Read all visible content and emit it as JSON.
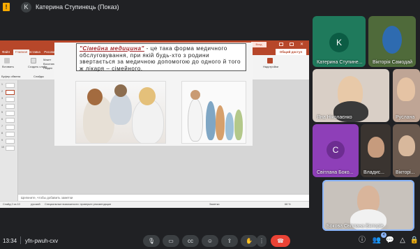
{
  "meet": {
    "presenter_initial": "K",
    "presenter_title": "Катерина Ступинець (Показ)",
    "time": "13:34",
    "meeting_code": "yfn-pwuh-cxv",
    "participants_badge": "4"
  },
  "powerpoint": {
    "window_title": "Загальне практика - сімейна медицина - PowerPoint",
    "signin": "Вход",
    "tabs": [
      "Файл",
      "Главная",
      "Вставка",
      "Рисование",
      "Конструктор",
      "Переходы",
      "Анимация",
      "Слайд-шоу",
      "Запись",
      "Рецензирование",
      "Вид",
      "Справка",
      "Что вы хотите сделать?"
    ],
    "active_tab_index": 1,
    "share_label": "Общий доступ",
    "ribbon": {
      "paste": "Вставить",
      "create_slide": "Создать слайд",
      "layout": "Макет",
      "reset": "Восстановить",
      "section": "Раздел",
      "shapes": "Фигуры",
      "arrange": "Упорядочить",
      "quick_styles": "Экспресс-стили",
      "find": "Найти",
      "replace": "Заменить",
      "select": "Выделить",
      "addins": "Надстройки",
      "clipboard": "Буфер обмена",
      "slides": "Слайды"
    },
    "slide_numbers": [
      "1",
      "2",
      "3",
      "4",
      "5",
      "6",
      "7",
      "8",
      "9",
      "10"
    ],
    "selected_slide": 2,
    "slide_lead": "\"Сімейна медицина\"",
    "slide_body": " - це така форма медичного обслуговування, при якій будь-хто з родини звертається за медичною допомогою до одного й того ж лікаря – сімейного.",
    "notes_placeholder": "Щелкните, чтобы добавить заметки",
    "status_slide": "Слайд 2 из 10",
    "status_lang": "русский",
    "status_accessibility": "Специальные возможности: проверьте рекомендации",
    "status_notes": "Заметки",
    "status_zoom": "68 %"
  },
  "participants": [
    {
      "name": "Катерина Ступине...",
      "initial": "K",
      "color": "#1f7a5c"
    },
    {
      "name": "Вікторія Самодай",
      "initial": "",
      "color": "#5a6e3c"
    },
    {
      "name": "Яна Ніколаєнко",
      "initial": "",
      "color": "#c9b8a6"
    },
    {
      "name": "Руслана",
      "initial": "",
      "color": "#bfa595"
    },
    {
      "name": "Світлана Боко...",
      "initial": "С",
      "color": "#8e3fb8"
    },
    {
      "name": "Владис...",
      "initial": "",
      "color": "#3a3430"
    },
    {
      "name": "Вікторі...",
      "initial": "",
      "color": "#6b5a4f"
    },
    {
      "name": "Бокова Світлана Вікторів...",
      "initial": "",
      "color": "#c8c2bc"
    }
  ],
  "icons": {
    "mic": "microphone-icon",
    "cam": "camera-icon",
    "cc": "captions-icon",
    "react": "emoji-icon",
    "present": "present-icon",
    "hand": "raise-hand-icon",
    "more": "more-icon",
    "leave": "hang-up-icon",
    "info": "info-icon",
    "people": "people-icon",
    "chat": "chat-icon",
    "activities": "activities-icon",
    "lock": "host-controls-icon"
  }
}
